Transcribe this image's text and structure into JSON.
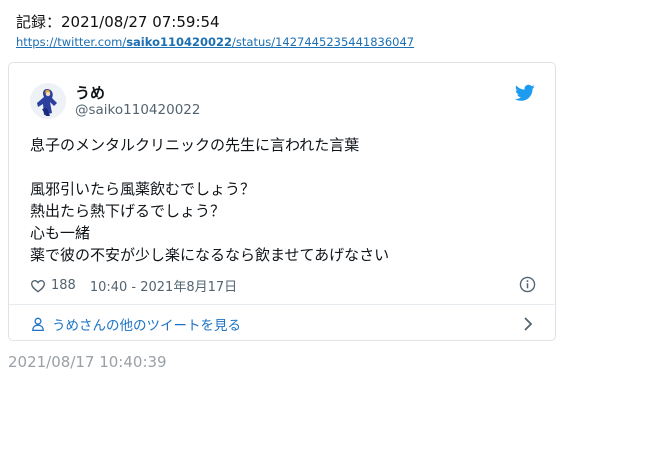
{
  "record": {
    "label": "記録：2021/08/27 07:59:54",
    "url_prefix": "https://twitter.com/",
    "url_user": "saiko110420022",
    "url_suffix": "/status/1427445235441836047"
  },
  "tweet": {
    "display_name": "うめ",
    "handle": "@saiko110420022",
    "lines": [
      "息子のメンタルクリニックの先生に言われた言葉",
      "",
      "風邪引いたら風薬飲むでしょう？",
      "熱出たら熱下げるでしょう？",
      "心も一緒",
      "薬で彼の不安が少し楽になるなら飲ませてあげなさい"
    ],
    "like_count": "188",
    "timestamp": "10:40 - 2021年8月17日",
    "footer_link": "うめさんの他のツイートを見る"
  },
  "saved_time": "2021/08/17 10:40:39",
  "icons": [
    "avatar",
    "twitter-bird-icon",
    "heart-icon",
    "info-icon",
    "person-icon",
    "chevron-right-icon"
  ],
  "colors": {
    "accent": "#1d9bf0",
    "link": "#1b6fb3",
    "muted": "#536471"
  }
}
